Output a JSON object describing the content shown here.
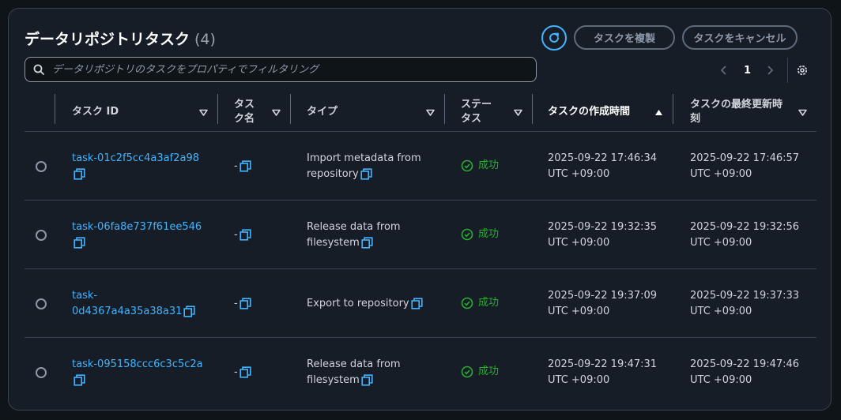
{
  "header": {
    "title": "データリポジトリタスク",
    "count": "(4)",
    "copy_button": "タスクを複製",
    "cancel_button": "タスクをキャンセル"
  },
  "filter": {
    "placeholder": "データリポジトリのタスクをプロパティでフィルタリング"
  },
  "pagination": {
    "current_page": "1"
  },
  "columns": {
    "task_id": "タスク ID",
    "task_name_1": "タス",
    "task_name_2": "ク名",
    "type": "タイプ",
    "status_1": "ステー",
    "status_2": "タス",
    "created": "タスクの作成時間",
    "updated_1": "タスクの最終更新時",
    "updated_2": "刻"
  },
  "sort": {
    "column": "created",
    "direction": "ascending"
  },
  "colors": {
    "link": "#42b4ff",
    "success": "#29ad32",
    "background": "#161d26"
  },
  "rows": [
    {
      "id_1": "task-01c2f5cc4a3af2a98",
      "id_2": "",
      "name": "-",
      "type_1": "Import metadata from",
      "type_2": "repository",
      "status": "成功",
      "created_1": "2025-09-22 17:46:34",
      "created_2": "UTC +09:00",
      "updated_1": "2025-09-22 17:46:57",
      "updated_2": "UTC +09:00"
    },
    {
      "id_1": "task-06fa8e737f61ee546",
      "id_2": "",
      "name": "-",
      "type_1": "Release data from",
      "type_2": "filesystem",
      "status": "成功",
      "created_1": "2025-09-22 19:32:35",
      "created_2": "UTC +09:00",
      "updated_1": "2025-09-22 19:32:56",
      "updated_2": "UTC +09:00"
    },
    {
      "id_1": "task-",
      "id_2": "0d4367a4a35a38a31",
      "name": "-",
      "type_1": "Export to repository",
      "type_2": "",
      "status": "成功",
      "created_1": "2025-09-22 19:37:09",
      "created_2": "UTC +09:00",
      "updated_1": "2025-09-22 19:37:33",
      "updated_2": "UTC +09:00"
    },
    {
      "id_1": "task-095158ccc6c3c5c2a",
      "id_2": "",
      "name": "-",
      "type_1": "Release data from",
      "type_2": "filesystem",
      "status": "成功",
      "created_1": "2025-09-22 19:47:31",
      "created_2": "UTC +09:00",
      "updated_1": "2025-09-22 19:47:46",
      "updated_2": "UTC +09:00"
    }
  ]
}
